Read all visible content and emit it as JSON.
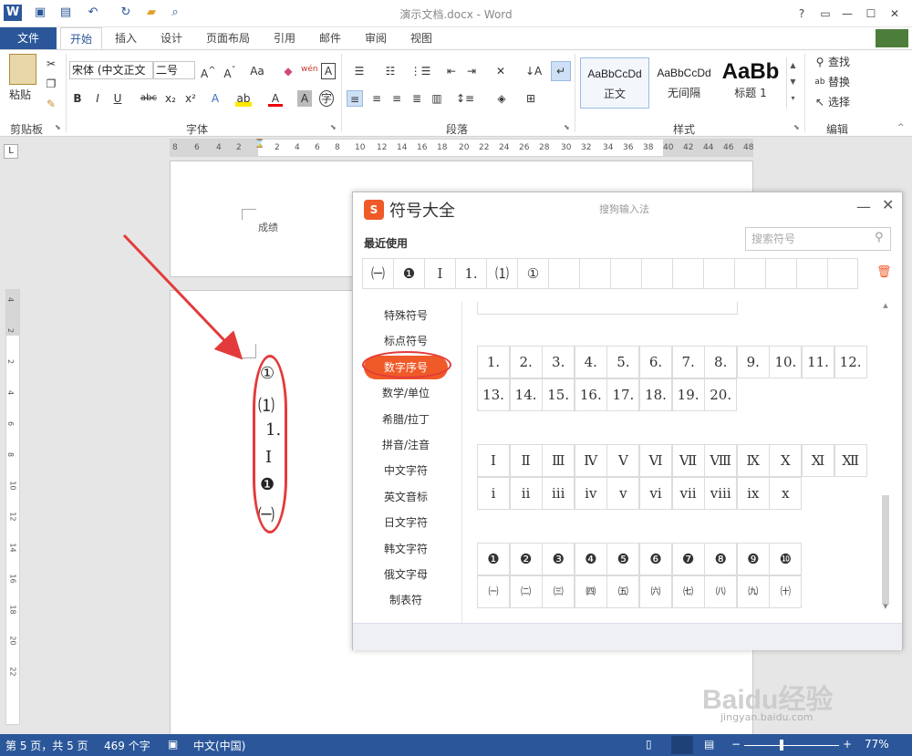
{
  "title": "演示文档.docx - Word",
  "quick_access": {
    "save": "保存",
    "undo": "撤销",
    "redo": "重复"
  },
  "tabs": [
    "文件",
    "开始",
    "插入",
    "设计",
    "页面布局",
    "引用",
    "邮件",
    "审阅",
    "视图"
  ],
  "ribbon": {
    "clipboard": {
      "paste": "粘贴",
      "group": "剪贴板"
    },
    "font": {
      "family": "宋体 (中文正文",
      "size": "二号",
      "group": "字体"
    },
    "paragraph": {
      "group": "段落"
    },
    "styles": {
      "group": "样式",
      "items": [
        {
          "preview": "AaBbCcDd",
          "name": "正文"
        },
        {
          "preview": "AaBbCcDd",
          "name": "无间隔"
        },
        {
          "preview": "AaBb",
          "name": "标题 1"
        }
      ]
    },
    "editing": {
      "group": "编辑",
      "find": "查找",
      "replace": "替换",
      "select": "选择"
    }
  },
  "ruler_numbers": [
    "8",
    "6",
    "4",
    "2",
    "2",
    "4",
    "6",
    "8",
    "10",
    "12",
    "14",
    "16",
    "18",
    "20",
    "22",
    "24",
    "26",
    "28",
    "30",
    "32",
    "34",
    "36",
    "38",
    "40",
    "42",
    "44",
    "46",
    "48"
  ],
  "vruler_numbers": [
    "4",
    "2",
    "2",
    "4",
    "6",
    "8",
    "10",
    "12",
    "14",
    "16",
    "18",
    "20",
    "22"
  ],
  "document": {
    "prev_page_text": "成绩",
    "symbols": [
      "①",
      "⑴",
      "1.",
      "Ⅰ",
      "❶",
      "㈠"
    ]
  },
  "dialog": {
    "title": "符号大全",
    "ime": "搜狗输入法",
    "recent_label": "最近使用",
    "search_placeholder": "搜索符号",
    "recent": [
      "㈠",
      "❶",
      "Ⅰ",
      "1.",
      "⑴",
      "①"
    ],
    "categories": [
      "特殊符号",
      "标点符号",
      "数字序号",
      "数学/单位",
      "希腊/拉丁",
      "拼音/注音",
      "中文字符",
      "英文音标",
      "日文字符",
      "韩文字符",
      "俄文字母",
      "制表符"
    ],
    "selected_category": "数字序号",
    "row_dot": [
      "1.",
      "2.",
      "3.",
      "4.",
      "5.",
      "6.",
      "7.",
      "8.",
      "9.",
      "10.",
      "11.",
      "12.",
      "13.",
      "14.",
      "15.",
      "16.",
      "17.",
      "18.",
      "19.",
      "20."
    ],
    "row_roman_upper": [
      "Ⅰ",
      "Ⅱ",
      "Ⅲ",
      "Ⅳ",
      "Ⅴ",
      "Ⅵ",
      "Ⅶ",
      "Ⅷ",
      "Ⅸ",
      "Ⅹ",
      "Ⅺ",
      "Ⅻ"
    ],
    "row_roman_lower": [
      "ⅰ",
      "ⅱ",
      "ⅲ",
      "ⅳ",
      "ⅴ",
      "ⅵ",
      "ⅶ",
      "ⅷ",
      "ⅸ",
      "ⅹ"
    ],
    "row_circled": [
      "❶",
      "❷",
      "❸",
      "❹",
      "❺",
      "❻",
      "❼",
      "❽",
      "❾",
      "❿"
    ],
    "row_paren": [
      "㈠",
      "㈡",
      "㈢",
      "㈣",
      "㈤",
      "㈥",
      "㈦",
      "㈧",
      "㈨",
      "㈩"
    ]
  },
  "status": {
    "page": "第 5 页，共 5 页",
    "words": "469 个字",
    "lang": "中文(中国)",
    "zoom": "77%"
  },
  "watermark": {
    "brand": "Baidu经验",
    "url": "jingyan.baidu.com"
  },
  "colors": {
    "accent": "#2b579a",
    "sogou": "#f05a28",
    "annotation": "#e33b3b"
  }
}
